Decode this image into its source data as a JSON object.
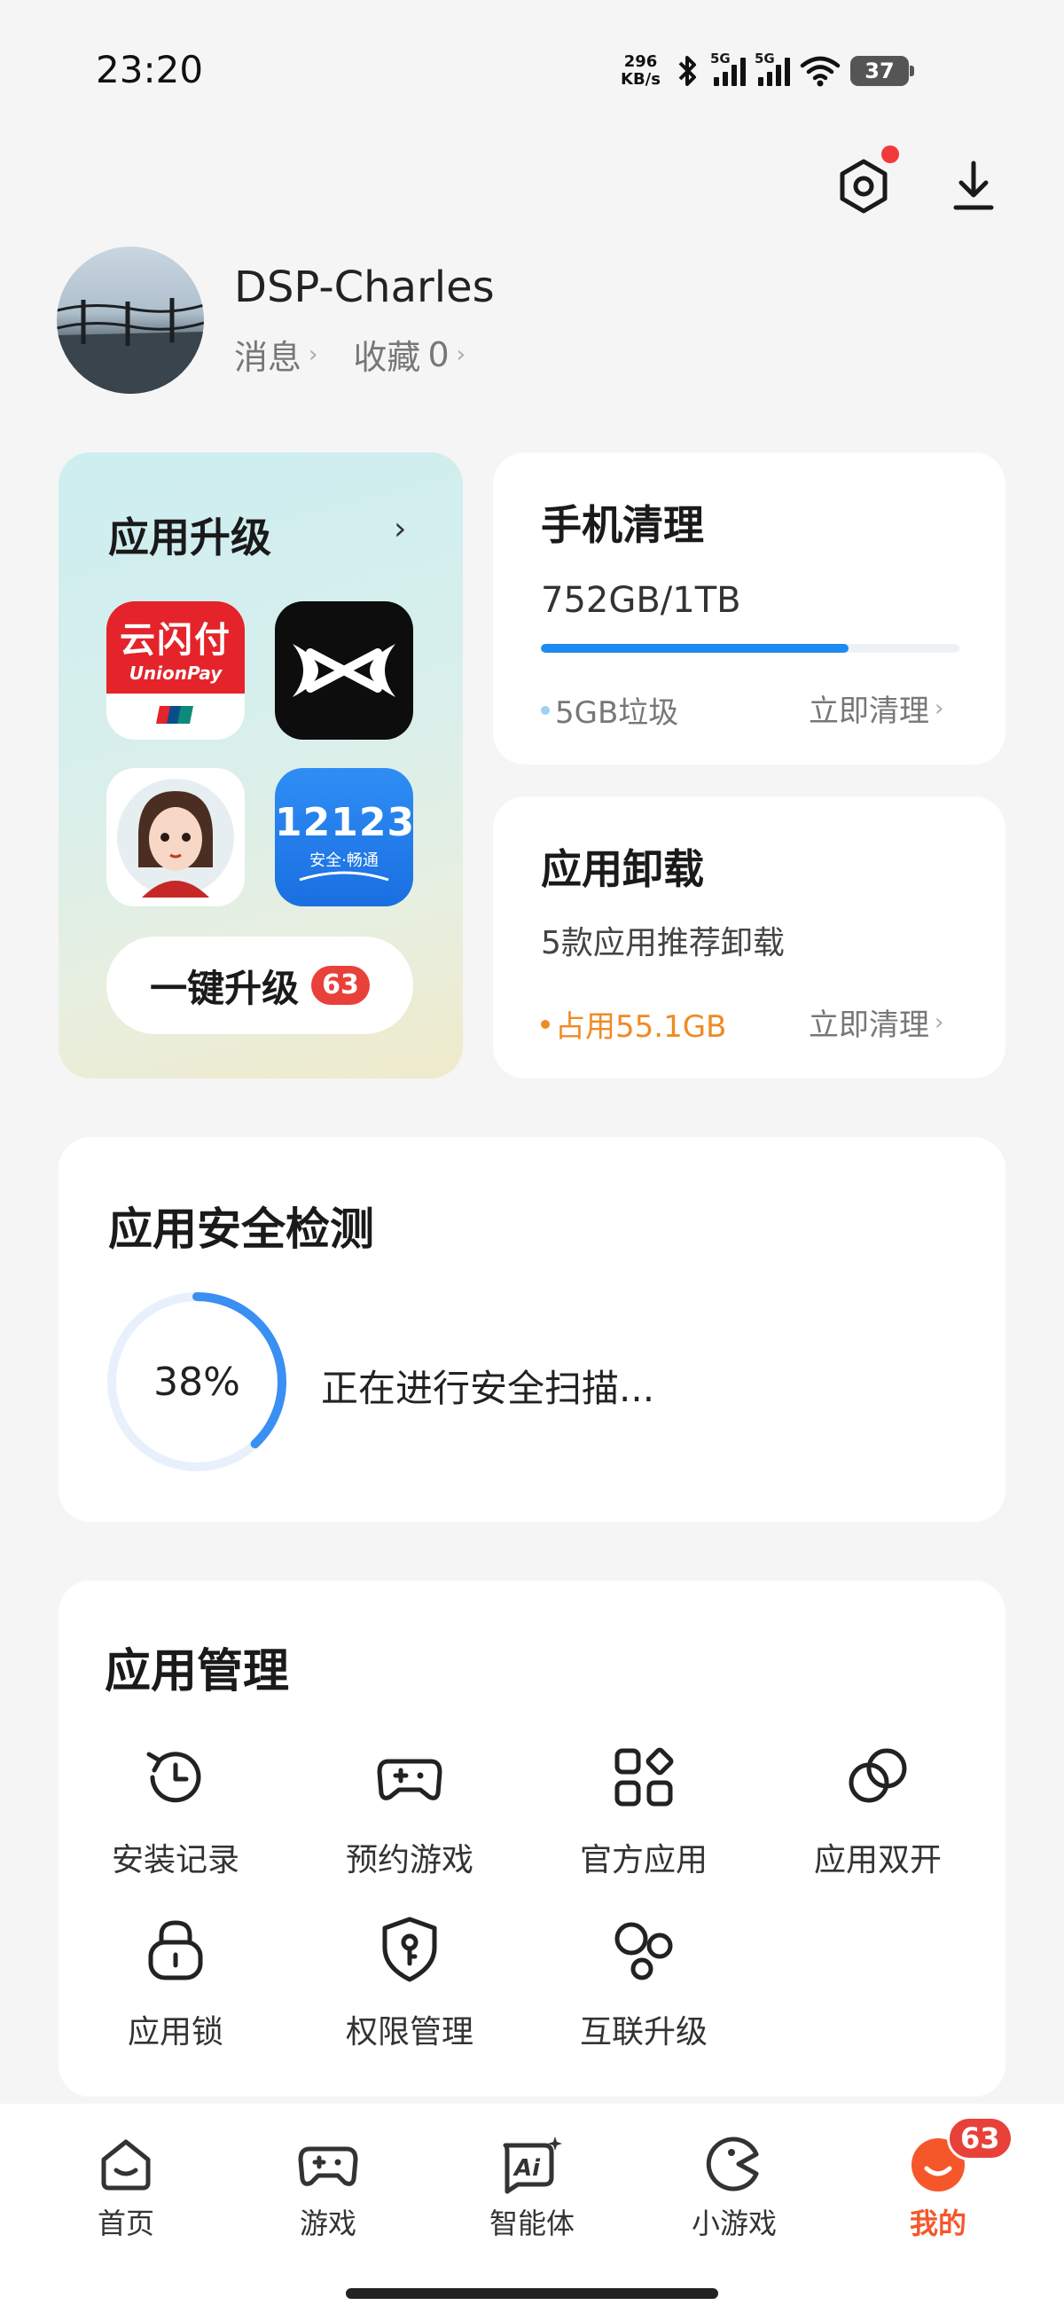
{
  "status_bar": {
    "time": "23:20",
    "net_speed_value": "296",
    "net_speed_unit": "KB/s",
    "sim1_label": "5G",
    "sim2_label": "5G",
    "battery": "37"
  },
  "header": {
    "settings_icon": "settings-hex-icon",
    "download_icon": "download-icon"
  },
  "profile": {
    "username": "DSP-Charles",
    "messages_label": "消息",
    "favorites_label": "收藏",
    "favorites_count": "0"
  },
  "app_upgrade": {
    "title": "应用升级",
    "apps": [
      {
        "name": "云闪付",
        "sub": "UnionPay"
      },
      {
        "name": "X"
      },
      {
        "name": "avatar-app"
      },
      {
        "name": "12123",
        "sub": "安全·畅通"
      }
    ],
    "one_key_label": "一键升级",
    "badge": "63"
  },
  "phone_clean": {
    "title": "手机清理",
    "storage": "752GB/1TB",
    "used_fraction": 0.7344,
    "junk": "5GB垃圾",
    "action": "立即清理"
  },
  "app_uninstall": {
    "title": "应用卸载",
    "subtitle": "5款应用推荐卸载",
    "occupied": "占用55.1GB",
    "action": "立即清理"
  },
  "security": {
    "title": "应用安全检测",
    "percent_label": "38%",
    "percent": 38,
    "status": "正在进行安全扫描..."
  },
  "app_management": {
    "title": "应用管理",
    "items": [
      {
        "label": "安装记录",
        "icon": "history-icon"
      },
      {
        "label": "预约游戏",
        "icon": "gamepad-plus-icon"
      },
      {
        "label": "官方应用",
        "icon": "official-apps-icon"
      },
      {
        "label": "应用双开",
        "icon": "dual-app-icon"
      },
      {
        "label": "应用锁",
        "icon": "lock-icon"
      },
      {
        "label": "权限管理",
        "icon": "shield-key-icon"
      },
      {
        "label": "互联升级",
        "icon": "connected-upgrade-icon"
      }
    ]
  },
  "tabbar": {
    "tabs": [
      {
        "label": "首页",
        "icon": "home-icon"
      },
      {
        "label": "游戏",
        "icon": "gamepad-icon"
      },
      {
        "label": "智能体",
        "icon": "ai-agent-icon"
      },
      {
        "label": "小游戏",
        "icon": "mini-game-icon"
      },
      {
        "label": "我的",
        "icon": "me-face-icon",
        "active": true,
        "badge": "63"
      }
    ],
    "active_color": "#f5572b"
  },
  "colors": {
    "accent_blue": "#1e8bf0",
    "warning_orange": "#f08a23",
    "badge_red": "#e8413a"
  }
}
